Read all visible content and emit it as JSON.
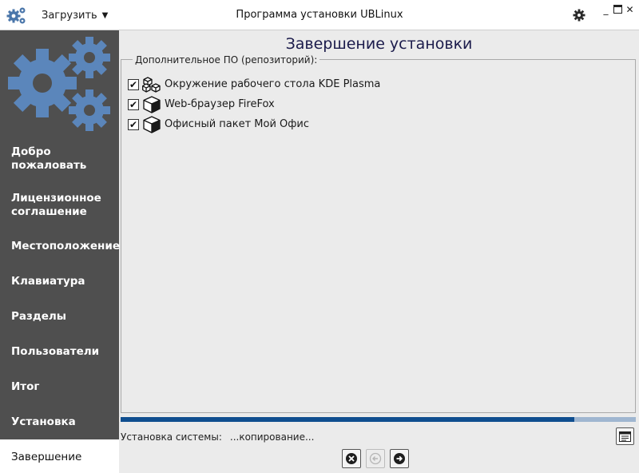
{
  "titlebar": {
    "menu_label": "Загрузить",
    "title": "Программа установки UBLinux",
    "icons": {
      "app": "gears-icon",
      "settings": "gear-icon",
      "minimize": "minimize-icon",
      "maximize": "maximize-icon",
      "close": "close-icon"
    }
  },
  "sidebar": {
    "items": [
      {
        "label": "Добро пожаловать"
      },
      {
        "label": "Лицензионное соглашение"
      },
      {
        "label": "Местоположение"
      },
      {
        "label": "Клавиатура"
      },
      {
        "label": "Разделы"
      },
      {
        "label": "Пользователи"
      },
      {
        "label": "Итог"
      },
      {
        "label": "Установка"
      },
      {
        "label": "Завершение",
        "active": true
      }
    ]
  },
  "main": {
    "title": "Завершение установки",
    "group_label": "Дополнительное ПО (репозиторий):",
    "packages": [
      {
        "label": "Окружение рабочего стола KDE Plasma",
        "checked": true,
        "icon": "packages-icon"
      },
      {
        "label": "Web-браузер FireFox",
        "checked": true,
        "icon": "package-icon"
      },
      {
        "label": "Офисный пакет Мой Офис",
        "checked": true,
        "icon": "package-icon"
      }
    ],
    "progress": 0.88,
    "status_label": "Установка системы:",
    "status_value": "...копирование..."
  },
  "colors": {
    "sidebar_bg": "#4f4f4f",
    "accent": "#0f4e8f",
    "logo": "#5b86bb"
  }
}
